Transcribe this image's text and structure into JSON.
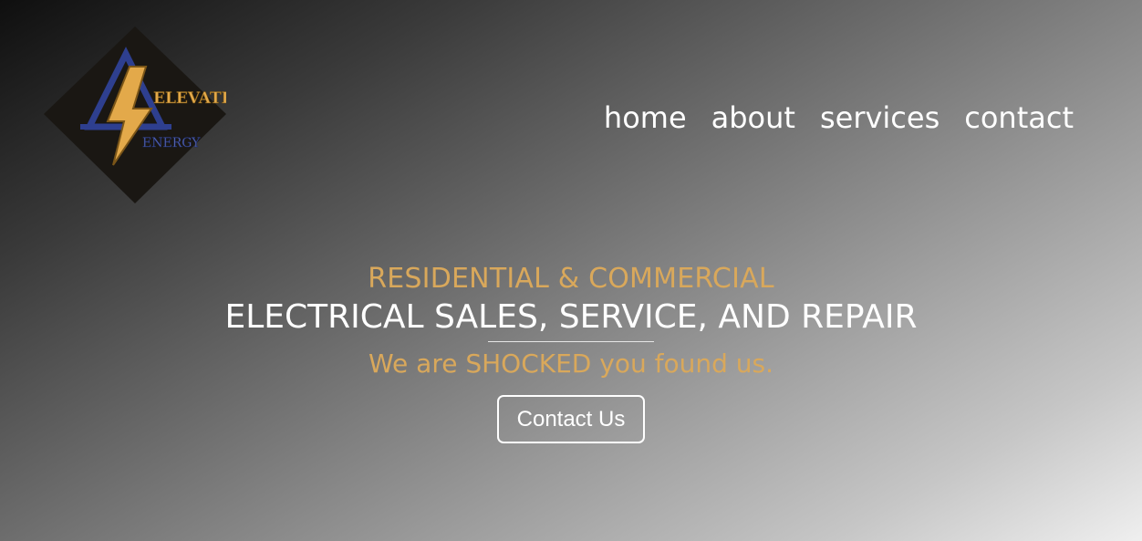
{
  "brand": {
    "logo_line1": "ELEVATED",
    "logo_line2": "ENERGY",
    "logo_icon": "lightning-bolt-icon",
    "accent_color": "#d9a85b",
    "logo_blue": "#2e3f8f"
  },
  "nav": {
    "items": [
      {
        "label": "home"
      },
      {
        "label": "about"
      },
      {
        "label": "services"
      },
      {
        "label": "contact"
      }
    ]
  },
  "hero": {
    "kicker": "RESIDENTIAL & COMMERCIAL",
    "title": "ELECTRICAL SALES, SERVICE, AND REPAIR",
    "tagline": "We are SHOCKED you found us.",
    "cta_label": "Contact Us"
  }
}
